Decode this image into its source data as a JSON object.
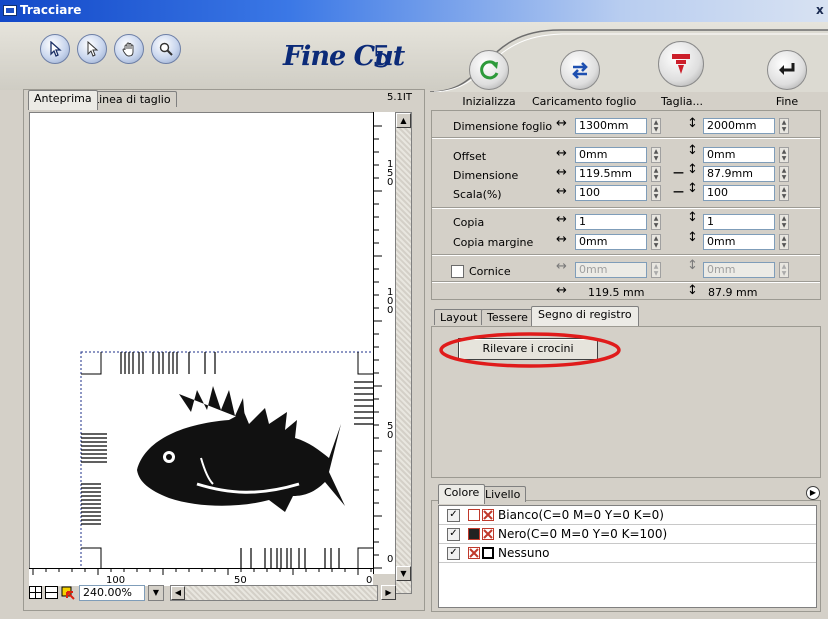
{
  "window": {
    "title": "Tracciare",
    "close": "x"
  },
  "logo": {
    "brand": "Fine Cut",
    "version": "5"
  },
  "toolbar": {
    "actions": [
      {
        "label": "Inizializza",
        "icon": "refresh-icon",
        "color": "#2d9a3a"
      },
      {
        "label": "Caricamento foglio",
        "icon": "swap-arrows-icon",
        "color": "#1d4fb0"
      },
      {
        "label": "Taglia...",
        "icon": "plotter-cutter-icon",
        "color": "#cc1f2a"
      },
      {
        "label": "Fine",
        "icon": "return-arrow-icon",
        "color": "#1a1a1a"
      }
    ]
  },
  "preview": {
    "tabs": [
      "Anteprima",
      "Linea di taglio"
    ],
    "version": "5.1IT",
    "zoom": "240.00%",
    "ruler_v": [
      "1\n5\n0",
      "1\n0\n0",
      "5\n0",
      "0"
    ],
    "ruler_h": [
      "100",
      "50",
      "0"
    ]
  },
  "settings": {
    "sheet": {
      "label": "Dimensione foglio",
      "w": "1300mm",
      "h": "2000mm"
    },
    "offset": {
      "label": "Offset",
      "w": "0mm",
      "h": "0mm"
    },
    "size": {
      "label": "Dimensione",
      "w": "119.5mm",
      "h": "87.9mm"
    },
    "scale": {
      "label": "Scala(%)",
      "w": "100",
      "h": "100"
    },
    "copy": {
      "label": "Copia",
      "w": "1",
      "h": "1"
    },
    "copy_margin": {
      "label": "Copia margine",
      "w": "0mm",
      "h": "0mm"
    },
    "frame": {
      "label": "Cornice",
      "w": "0mm",
      "h": "0mm"
    },
    "total": {
      "w": "119.5 mm",
      "h": "87.9 mm"
    }
  },
  "glyphs": {
    "horiz": "↔",
    "vert": "↕",
    "link": "—"
  },
  "registration": {
    "tabs": [
      "Layout",
      "Tessere",
      "Segno di registro"
    ],
    "detect_button": "Rilevare i crocini",
    "highlight_color": "#e01b1b"
  },
  "layers": {
    "tabs": [
      "Colore",
      "Livello"
    ],
    "rows": [
      {
        "name": "Bianco(C=0 M=0 Y=0 K=0)",
        "checked": "✓"
      },
      {
        "name": "Nero(C=0 M=0 Y=0 K=100)",
        "checked": "✓"
      },
      {
        "name": "Nessuno",
        "checked": "✓"
      }
    ]
  }
}
